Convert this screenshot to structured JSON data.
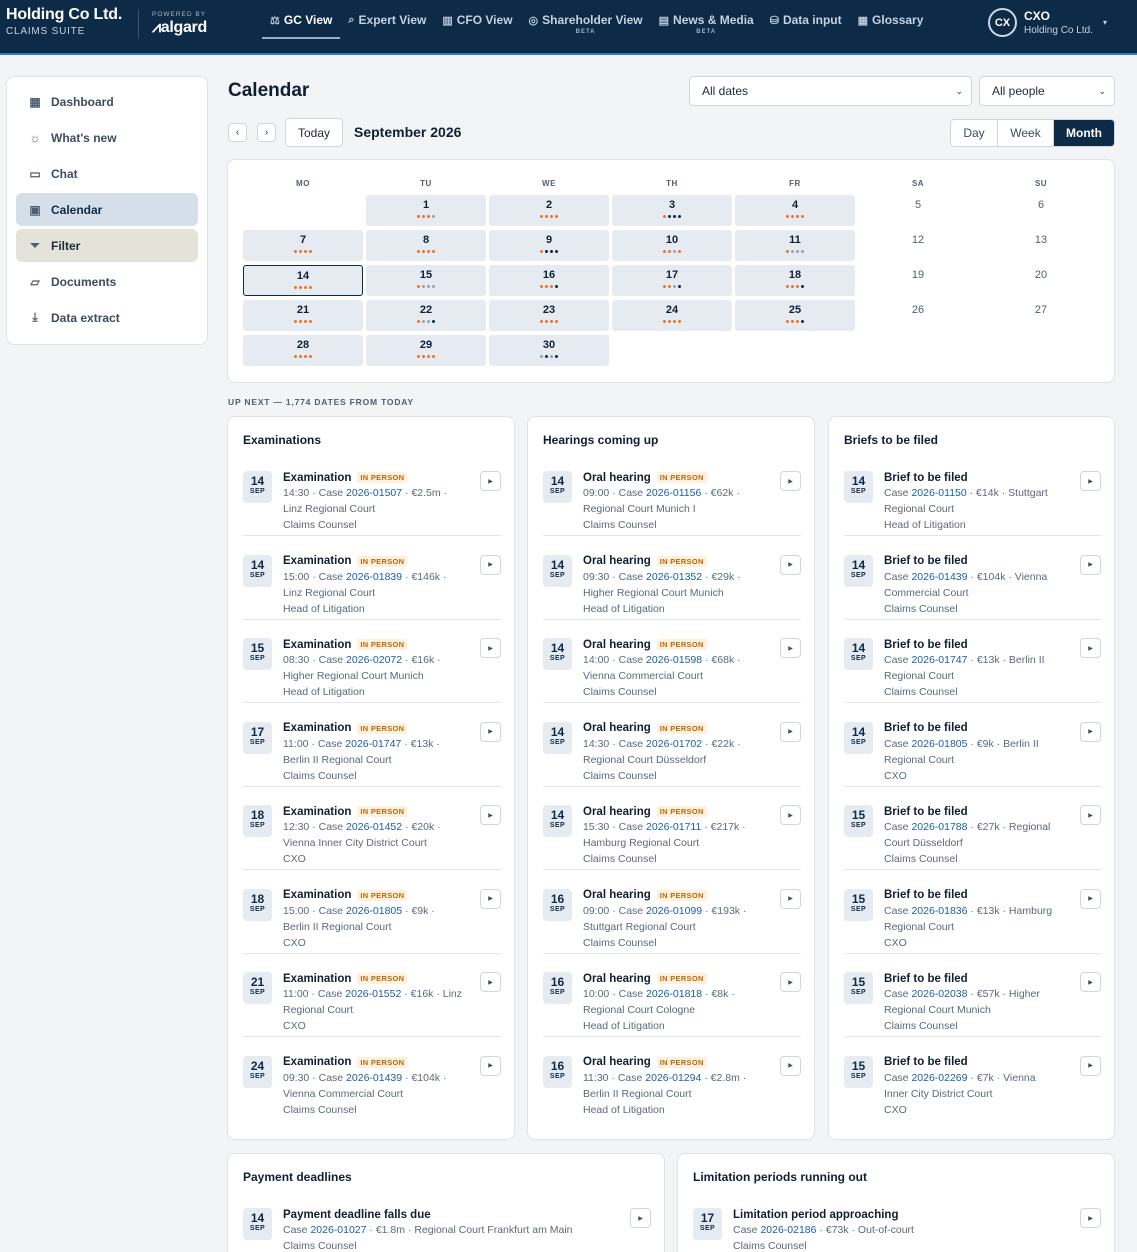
{
  "header": {
    "brand": {
      "name": "Holding Co Ltd.",
      "suite": "CLAIMS SUITE",
      "powered_by": "POWERED BY",
      "logo": "algard"
    },
    "nav": [
      {
        "label": "GC View",
        "icon": "scale-icon",
        "glyph": "⚖",
        "beta": "",
        "active": true
      },
      {
        "label": "Expert View",
        "icon": "search-icon",
        "glyph": "⌕",
        "beta": "",
        "active": false
      },
      {
        "label": "CFO View",
        "icon": "bar-chart-icon",
        "glyph": "▥",
        "beta": "",
        "active": false
      },
      {
        "label": "Shareholder View",
        "icon": "compass-icon",
        "glyph": "◎",
        "beta": "BETA",
        "active": false
      },
      {
        "label": "News & Media",
        "icon": "newspaper-icon",
        "glyph": "▤",
        "beta": "BETA",
        "active": false
      },
      {
        "label": "Data input",
        "icon": "database-icon",
        "glyph": "⛁",
        "beta": "",
        "active": false
      },
      {
        "label": "Glossary",
        "icon": "book-icon",
        "glyph": "▦",
        "beta": "",
        "active": false
      }
    ],
    "user": {
      "initials": "CX",
      "name": "CXO",
      "org": "Holding Co Ltd."
    }
  },
  "sidebar": {
    "items": [
      {
        "label": "Dashboard",
        "icon": "grid-icon",
        "glyph": "▦",
        "state": ""
      },
      {
        "label": "What's new",
        "icon": "sun-icon",
        "glyph": "☼",
        "state": ""
      },
      {
        "label": "Chat",
        "icon": "chat-icon",
        "glyph": "▭",
        "state": ""
      },
      {
        "label": "Calendar",
        "icon": "calendar-icon",
        "glyph": "▣",
        "state": "active"
      },
      {
        "label": "Filter",
        "icon": "filter-icon",
        "glyph": "⏷",
        "state": "filter"
      },
      {
        "label": "Documents",
        "icon": "folder-icon",
        "glyph": "▱",
        "state": ""
      },
      {
        "label": "Data extract",
        "icon": "download-icon",
        "glyph": "⤓",
        "state": ""
      }
    ]
  },
  "page": {
    "title": "Calendar",
    "date_filter": "All dates",
    "people_filter": "All people",
    "today_label": "Today",
    "month_label": "September 2026",
    "prev_glyph": "‹",
    "next_glyph": "›",
    "views": [
      {
        "label": "Day",
        "active": false
      },
      {
        "label": "Week",
        "active": false
      },
      {
        "label": "Month",
        "active": true
      }
    ],
    "up_next": "UP NEXT — 1,774 DATES FROM TODAY"
  },
  "colors": {
    "orange": "#e8772e",
    "grey": "#9aa5b1",
    "navy": "#0d2a47",
    "blue": "#1a5ea8"
  },
  "calendar": {
    "weekdays": [
      "MO",
      "TU",
      "WE",
      "TH",
      "FR",
      "SA",
      "SU"
    ],
    "first_weekday_index": 1,
    "selected_day": 14,
    "weekend_days": [
      5,
      6,
      12,
      13,
      19,
      20,
      26,
      27
    ],
    "event_days": {
      "1": [
        "orange",
        "orange",
        "orange",
        "grey"
      ],
      "2": [
        "orange",
        "orange",
        "orange",
        "orange"
      ],
      "3": [
        "orange",
        "navy",
        "navy",
        "navy"
      ],
      "4": [
        "orange",
        "orange",
        "orange",
        "orange"
      ],
      "7": [
        "orange",
        "orange",
        "orange",
        "orange"
      ],
      "8": [
        "orange",
        "orange",
        "orange",
        "orange"
      ],
      "9": [
        "orange",
        "navy",
        "navy",
        "navy"
      ],
      "10": [
        "orange",
        "orange",
        "grey",
        "orange"
      ],
      "11": [
        "orange",
        "grey",
        "grey",
        "grey"
      ],
      "14": [
        "orange",
        "orange",
        "orange",
        "orange"
      ],
      "15": [
        "orange",
        "grey",
        "grey",
        "grey"
      ],
      "16": [
        "orange",
        "orange",
        "orange",
        "navy"
      ],
      "17": [
        "orange",
        "orange",
        "grey",
        "navy"
      ],
      "18": [
        "orange",
        "orange",
        "orange",
        "navy"
      ],
      "21": [
        "orange",
        "orange",
        "orange",
        "orange"
      ],
      "22": [
        "orange",
        "grey",
        "grey",
        "navy"
      ],
      "23": [
        "orange",
        "orange",
        "orange",
        "orange"
      ],
      "24": [
        "orange",
        "orange",
        "orange",
        "orange"
      ],
      "25": [
        "orange",
        "orange",
        "orange",
        "navy"
      ],
      "28": [
        "orange",
        "orange",
        "orange",
        "orange"
      ],
      "29": [
        "orange",
        "orange",
        "orange",
        "orange"
      ],
      "30": [
        "grey",
        "navy",
        "grey",
        "navy"
      ]
    },
    "days_in_month": 30
  },
  "panels": [
    {
      "title": "Examinations",
      "items": [
        {
          "day": "14",
          "mon": "SEP",
          "title": "Examination",
          "tag": "IN PERSON",
          "pre": "14:30 · Case ",
          "case": "2026-01507",
          "post": " · €2.5m ·",
          "line2": "Linz Regional Court",
          "line3": "Claims Counsel"
        },
        {
          "day": "14",
          "mon": "SEP",
          "title": "Examination",
          "tag": "IN PERSON",
          "pre": "15:00 · Case ",
          "case": "2026-01839",
          "post": " · €146k ·",
          "line2": "Linz Regional Court",
          "line3": "Head of Litigation"
        },
        {
          "day": "15",
          "mon": "SEP",
          "title": "Examination",
          "tag": "IN PERSON",
          "pre": "08:30 · Case ",
          "case": "2026-02072",
          "post": " · €16k ·",
          "line2": "Higher Regional Court Munich",
          "line3": "Head of Litigation"
        },
        {
          "day": "17",
          "mon": "SEP",
          "title": "Examination",
          "tag": "IN PERSON",
          "pre": "11:00 · Case ",
          "case": "2026-01747",
          "post": " · €13k ·",
          "line2": "Berlin II Regional Court",
          "line3": "Claims Counsel"
        },
        {
          "day": "18",
          "mon": "SEP",
          "title": "Examination",
          "tag": "IN PERSON",
          "pre": "12:30 · Case ",
          "case": "2026-01452",
          "post": " · €20k ·",
          "line2": "Vienna Inner City District Court",
          "line3": "CXO"
        },
        {
          "day": "18",
          "mon": "SEP",
          "title": "Examination",
          "tag": "IN PERSON",
          "pre": "15:00 · Case ",
          "case": "2026-01805",
          "post": " · €9k ·",
          "line2": "Berlin II Regional Court",
          "line3": "CXO"
        },
        {
          "day": "21",
          "mon": "SEP",
          "title": "Examination",
          "tag": "IN PERSON",
          "pre": "11:00 · Case ",
          "case": "2026-01552",
          "post": " · €16k · Linz",
          "line2": "Regional Court",
          "line3": "CXO"
        },
        {
          "day": "24",
          "mon": "SEP",
          "title": "Examination",
          "tag": "IN PERSON",
          "pre": "09:30 · Case ",
          "case": "2026-01439",
          "post": " · €104k ·",
          "line2": "Vienna Commercial Court",
          "line3": "Claims Counsel"
        }
      ]
    },
    {
      "title": "Hearings coming up",
      "items": [
        {
          "day": "14",
          "mon": "SEP",
          "title": "Oral hearing",
          "tag": "IN PERSON",
          "pre": "09:00 · Case ",
          "case": "2026-01156",
          "post": " · €62k ·",
          "line2": "Regional Court Munich I",
          "line3": "Claims Counsel"
        },
        {
          "day": "14",
          "mon": "SEP",
          "title": "Oral hearing",
          "tag": "IN PERSON",
          "pre": "09:30 · Case ",
          "case": "2026-01352",
          "post": " · €29k ·",
          "line2": "Higher Regional Court Munich",
          "line3": "Head of Litigation"
        },
        {
          "day": "14",
          "mon": "SEP",
          "title": "Oral hearing",
          "tag": "IN PERSON",
          "pre": "14:00 · Case ",
          "case": "2026-01598",
          "post": " · €68k ·",
          "line2": "Vienna Commercial Court",
          "line3": "Claims Counsel"
        },
        {
          "day": "14",
          "mon": "SEP",
          "title": "Oral hearing",
          "tag": "IN PERSON",
          "pre": "14:30 · Case ",
          "case": "2026-01702",
          "post": " · €22k ·",
          "line2": "Regional Court Düsseldorf",
          "line3": "Claims Counsel"
        },
        {
          "day": "14",
          "mon": "SEP",
          "title": "Oral hearing",
          "tag": "IN PERSON",
          "pre": "15:30 · Case ",
          "case": "2026-01711",
          "post": " · €217k ·",
          "line2": "Hamburg Regional Court",
          "line3": "Claims Counsel"
        },
        {
          "day": "16",
          "mon": "SEP",
          "title": "Oral hearing",
          "tag": "IN PERSON",
          "pre": "09:00 · Case ",
          "case": "2026-01099",
          "post": " · €193k ·",
          "line2": "Stuttgart Regional Court",
          "line3": "Claims Counsel"
        },
        {
          "day": "16",
          "mon": "SEP",
          "title": "Oral hearing",
          "tag": "IN PERSON",
          "pre": "10:00 · Case ",
          "case": "2026-01818",
          "post": " · €8k ·",
          "line2": "Regional Court Cologne",
          "line3": "Head of Litigation"
        },
        {
          "day": "16",
          "mon": "SEP",
          "title": "Oral hearing",
          "tag": "IN PERSON",
          "pre": "11:30 · Case ",
          "case": "2026-01294",
          "post": " · €2.8m ·",
          "line2": "Berlin II Regional Court",
          "line3": "Head of Litigation"
        }
      ]
    },
    {
      "title": "Briefs to be filed",
      "items": [
        {
          "day": "14",
          "mon": "SEP",
          "title": "Brief to be filed",
          "tag": "",
          "pre": "Case ",
          "case": "2026-01150",
          "post": " · €14k · Stuttgart",
          "line2": "Regional Court",
          "line3": "Head of Litigation"
        },
        {
          "day": "14",
          "mon": "SEP",
          "title": "Brief to be filed",
          "tag": "",
          "pre": "Case ",
          "case": "2026-01439",
          "post": " · €104k · Vienna",
          "line2": "Commercial Court",
          "line3": "Claims Counsel"
        },
        {
          "day": "14",
          "mon": "SEP",
          "title": "Brief to be filed",
          "tag": "",
          "pre": "Case ",
          "case": "2026-01747",
          "post": " · €13k · Berlin II",
          "line2": "Regional Court",
          "line3": "Claims Counsel"
        },
        {
          "day": "14",
          "mon": "SEP",
          "title": "Brief to be filed",
          "tag": "",
          "pre": "Case ",
          "case": "2026-01805",
          "post": " · €9k · Berlin II",
          "line2": "Regional Court",
          "line3": "CXO"
        },
        {
          "day": "15",
          "mon": "SEP",
          "title": "Brief to be filed",
          "tag": "",
          "pre": "Case ",
          "case": "2026-01788",
          "post": " · €27k · Regional",
          "line2": "Court Düsseldorf",
          "line3": "Claims Counsel"
        },
        {
          "day": "15",
          "mon": "SEP",
          "title": "Brief to be filed",
          "tag": "",
          "pre": "Case ",
          "case": "2026-01836",
          "post": " · €13k · Hamburg",
          "line2": "Regional Court",
          "line3": "CXO"
        },
        {
          "day": "15",
          "mon": "SEP",
          "title": "Brief to be filed",
          "tag": "",
          "pre": "Case ",
          "case": "2026-02038",
          "post": " · €57k · Higher",
          "line2": "Regional Court Munich",
          "line3": "Claims Counsel"
        },
        {
          "day": "15",
          "mon": "SEP",
          "title": "Brief to be filed",
          "tag": "",
          "pre": "Case ",
          "case": "2026-02269",
          "post": " · €7k · Vienna",
          "line2": "Inner City District Court",
          "line3": "CXO"
        }
      ]
    },
    {
      "title": "Payment deadlines",
      "items": [
        {
          "day": "14",
          "mon": "SEP",
          "title": "Payment deadline falls due",
          "tag": "",
          "pre": "Case ",
          "case": "2026-01027",
          "post": " · €1.8m · Regional Court Frankfurt am Main",
          "line2": "Claims Counsel",
          "line3": ""
        }
      ]
    },
    {
      "title": "Limitation periods running out",
      "items": [
        {
          "day": "17",
          "mon": "SEP",
          "title": "Limitation period approaching",
          "tag": "",
          "pre": "Case ",
          "case": "2026-02186",
          "post": " · €73k · Out-of-court",
          "line2": "Claims Counsel",
          "line3": ""
        }
      ]
    }
  ]
}
